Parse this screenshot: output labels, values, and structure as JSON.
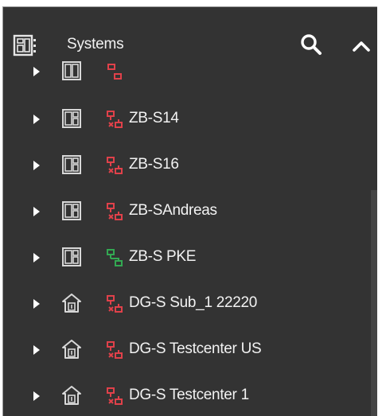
{
  "header": {
    "title": "Systems",
    "icons": {
      "systems": "systems-panel-icon",
      "search": "search-icon",
      "collapse": "chevron-up-icon"
    }
  },
  "colors": {
    "panel_bg": "#333333",
    "text": "#f2f2f2",
    "disconnected": "#e0414a",
    "connected": "#33a852",
    "icon_outline": "#d8d8d8"
  },
  "tree": {
    "items": [
      {
        "label": "ZB-S14",
        "type": "switchboard",
        "status": "disconnected"
      },
      {
        "label": "ZB-S16",
        "type": "switchboard",
        "status": "disconnected"
      },
      {
        "label": "ZB-SAndreas",
        "type": "switchboard",
        "status": "disconnected"
      },
      {
        "label": "ZB-S PKE",
        "type": "switchboard",
        "status": "connected"
      },
      {
        "label": "DG-S Sub_1 22220",
        "type": "substation",
        "status": "disconnected"
      },
      {
        "label": "DG-S Testcenter US",
        "type": "substation",
        "status": "disconnected"
      },
      {
        "label": "DG-S Testcenter 1",
        "type": "substation",
        "status": "disconnected"
      }
    ]
  }
}
